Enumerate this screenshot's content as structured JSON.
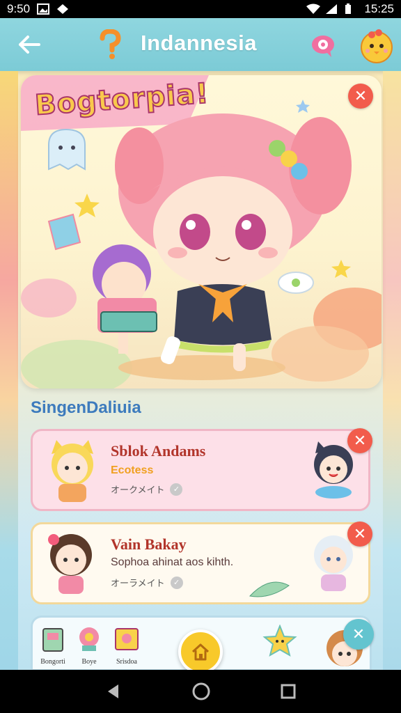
{
  "status_bar": {
    "time_left": "9:50",
    "time_right": "15:25"
  },
  "header": {
    "title": "Indannesia"
  },
  "hero": {
    "title": "Bogtorpia!"
  },
  "section": {
    "title": "SingenDaliuia"
  },
  "cards": [
    {
      "name": "Sblok Andams",
      "subtitle": "Ecotess",
      "meta": "オークメイト"
    },
    {
      "name": "Vain Bakay",
      "subtitle": "Sophoa ahinat aos kihth.",
      "meta": "オーラメイト"
    }
  ],
  "tray": {
    "items": [
      {
        "label": "Bongorti"
      },
      {
        "label": "Boye"
      },
      {
        "label": "Srisdoa"
      }
    ]
  },
  "colors": {
    "header": "#7ccbd6",
    "close": "#f25c4c",
    "section_title": "#3d7bbd",
    "fab": "#f8c92a"
  }
}
